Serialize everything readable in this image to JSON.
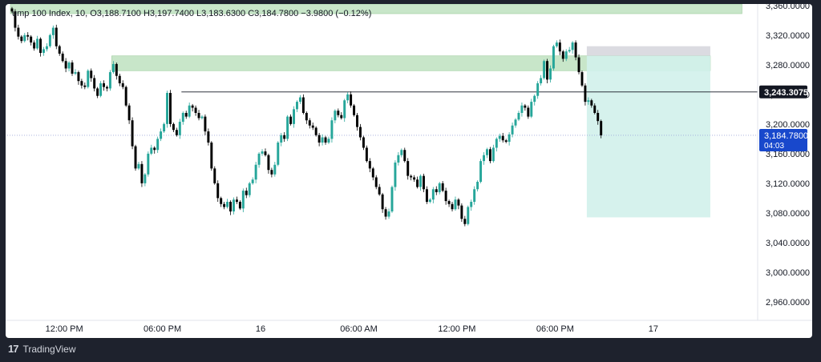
{
  "legend": {
    "symbol": "ump 100 Index, 10,",
    "o": "O3,188.7100",
    "h": "H3,197.7400",
    "l": "L3,183.6300",
    "c": "C3,184.7800",
    "chg": "−3.9800 (−0.12%)"
  },
  "footer": {
    "logo_glyph": "17",
    "brand": "TradingView"
  },
  "tags": {
    "level": "3,243.3075",
    "last": "3,184.7800",
    "countdown": "04:03"
  },
  "colors": {
    "up": "#26a69a",
    "down": "#000000",
    "zone": "#c8e6c9",
    "target": "#d2f1eb",
    "stop": "#d5d5dc",
    "last_bg": "#1848cc"
  },
  "chart_data": {
    "type": "candlestick",
    "ylim": [
      2935,
      3362
    ],
    "y_ticks": [
      "3,360.0000",
      "3,320.0000",
      "3,280.0000",
      "3,240.0000",
      "3,200.0000",
      "3,160.0000",
      "3,120.0000",
      "3,080.0000",
      "3,040.0000",
      "3,000.0000",
      "2,960.0000"
    ],
    "y_tick_values": [
      3360,
      3320,
      3280,
      3240,
      3200,
      3160,
      3120,
      3080,
      3040,
      3000,
      2960
    ],
    "x_ticks": [
      "12:00 PM",
      "06:00 PM",
      "16",
      "06:00 AM",
      "12:00 PM",
      "06:00 PM",
      "17"
    ],
    "x_tick_bar_index": [
      17,
      48,
      79,
      110,
      141,
      172,
      203
    ],
    "horizontal_level": 3243.3075,
    "last_price": 3184.78,
    "zones": [
      {
        "name": "top-zone",
        "y1": 3362,
        "y2": 3349,
        "bar_start": 0,
        "bar_end": 231
      },
      {
        "name": "mid-zone",
        "y1": 3292,
        "y2": 3272,
        "bar_start": 32,
        "bar_end": 221
      }
    ],
    "position": {
      "entry": 3292,
      "stop": 3305,
      "target": 3074,
      "bar_start": 182,
      "bar_end": 221
    },
    "closes": [
      3352,
      3330,
      3318,
      3312,
      3320,
      3318,
      3310,
      3302,
      3315,
      3296,
      3301,
      3305,
      3320,
      3330,
      3305,
      3295,
      3285,
      3275,
      3283,
      3268,
      3270,
      3258,
      3252,
      3250,
      3272,
      3262,
      3248,
      3238,
      3255,
      3250,
      3248,
      3270,
      3281,
      3265,
      3255,
      3250,
      3225,
      3205,
      3170,
      3140,
      3146,
      3120,
      3132,
      3160,
      3168,
      3165,
      3180,
      3190,
      3200,
      3242,
      3200,
      3192,
      3185,
      3203,
      3215,
      3210,
      3225,
      3222,
      3215,
      3208,
      3210,
      3190,
      3175,
      3140,
      3120,
      3100,
      3092,
      3088,
      3095,
      3082,
      3098,
      3095,
      3086,
      3110,
      3104,
      3120,
      3125,
      3145,
      3160,
      3163,
      3158,
      3138,
      3132,
      3145,
      3175,
      3185,
      3180,
      3210,
      3200,
      3220,
      3230,
      3236,
      3215,
      3205,
      3198,
      3195,
      3185,
      3175,
      3182,
      3175,
      3180,
      3205,
      3218,
      3212,
      3208,
      3232,
      3240,
      3225,
      3212,
      3196,
      3182,
      3168,
      3150,
      3140,
      3128,
      3115,
      3105,
      3085,
      3075,
      3082,
      3115,
      3148,
      3158,
      3165,
      3150,
      3130,
      3128,
      3125,
      3115,
      3130,
      3112,
      3095,
      3098,
      3112,
      3108,
      3120,
      3110,
      3096,
      3092,
      3085,
      3098,
      3090,
      3072,
      3065,
      3088,
      3095,
      3112,
      3122,
      3150,
      3158,
      3166,
      3150,
      3168,
      3180,
      3184,
      3178,
      3176,
      3186,
      3198,
      3206,
      3215,
      3225,
      3222,
      3210,
      3230,
      3238,
      3255,
      3262,
      3285,
      3260,
      3275,
      3305,
      3310,
      3298,
      3288,
      3298,
      3300,
      3310,
      3290,
      3270,
      3252,
      3230,
      3232,
      3225,
      3215,
      3204,
      3184.78
    ]
  }
}
